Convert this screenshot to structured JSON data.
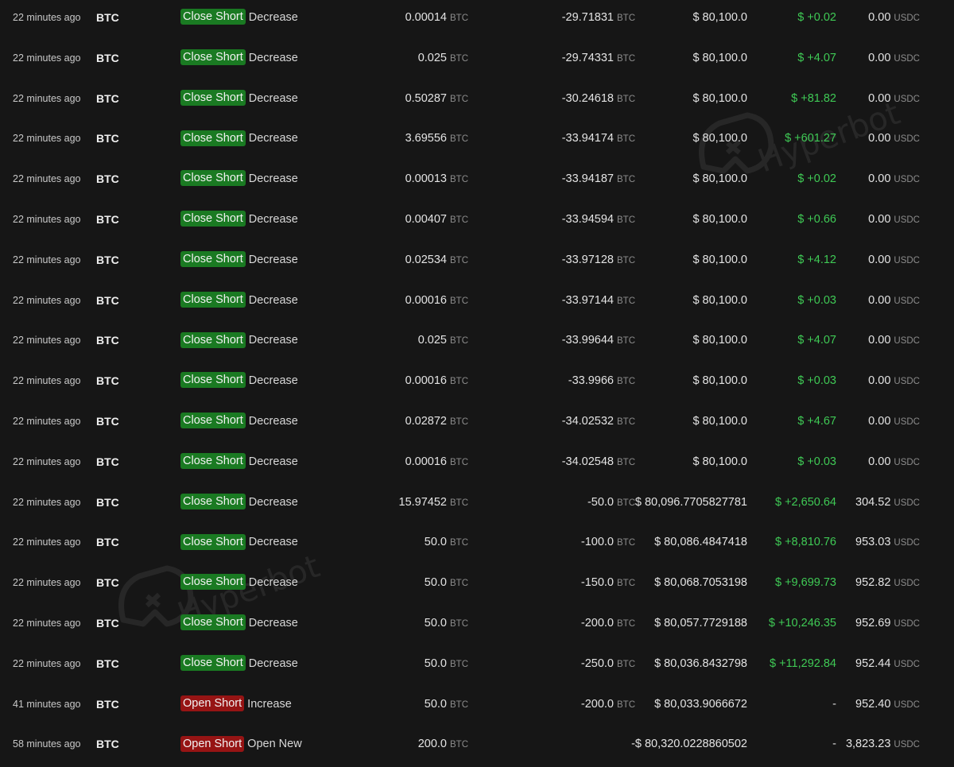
{
  "watermark": {
    "text": "Hyperbot"
  },
  "rows": [
    {
      "time": "22 minutes ago",
      "coin": "BTC",
      "type": "Close Short",
      "type_color": "green",
      "action": "Decrease",
      "size": "0.00014",
      "size_unit": "BTC",
      "position": "-29.71831",
      "position_unit": "BTC",
      "price": "$ 80,100.0",
      "pnl": "$ +0.02",
      "pnl_color": "green",
      "fee": "0.00",
      "fee_unit": "USDC"
    },
    {
      "time": "22 minutes ago",
      "coin": "BTC",
      "type": "Close Short",
      "type_color": "green",
      "action": "Decrease",
      "size": "0.025",
      "size_unit": "BTC",
      "position": "-29.74331",
      "position_unit": "BTC",
      "price": "$ 80,100.0",
      "pnl": "$ +4.07",
      "pnl_color": "green",
      "fee": "0.00",
      "fee_unit": "USDC"
    },
    {
      "time": "22 minutes ago",
      "coin": "BTC",
      "type": "Close Short",
      "type_color": "green",
      "action": "Decrease",
      "size": "0.50287",
      "size_unit": "BTC",
      "position": "-30.24618",
      "position_unit": "BTC",
      "price": "$ 80,100.0",
      "pnl": "$ +81.82",
      "pnl_color": "green",
      "fee": "0.00",
      "fee_unit": "USDC"
    },
    {
      "time": "22 minutes ago",
      "coin": "BTC",
      "type": "Close Short",
      "type_color": "green",
      "action": "Decrease",
      "size": "3.69556",
      "size_unit": "BTC",
      "position": "-33.94174",
      "position_unit": "BTC",
      "price": "$ 80,100.0",
      "pnl": "$ +601.27",
      "pnl_color": "green",
      "fee": "0.00",
      "fee_unit": "USDC"
    },
    {
      "time": "22 minutes ago",
      "coin": "BTC",
      "type": "Close Short",
      "type_color": "green",
      "action": "Decrease",
      "size": "0.00013",
      "size_unit": "BTC",
      "position": "-33.94187",
      "position_unit": "BTC",
      "price": "$ 80,100.0",
      "pnl": "$ +0.02",
      "pnl_color": "green",
      "fee": "0.00",
      "fee_unit": "USDC"
    },
    {
      "time": "22 minutes ago",
      "coin": "BTC",
      "type": "Close Short",
      "type_color": "green",
      "action": "Decrease",
      "size": "0.00407",
      "size_unit": "BTC",
      "position": "-33.94594",
      "position_unit": "BTC",
      "price": "$ 80,100.0",
      "pnl": "$ +0.66",
      "pnl_color": "green",
      "fee": "0.00",
      "fee_unit": "USDC"
    },
    {
      "time": "22 minutes ago",
      "coin": "BTC",
      "type": "Close Short",
      "type_color": "green",
      "action": "Decrease",
      "size": "0.02534",
      "size_unit": "BTC",
      "position": "-33.97128",
      "position_unit": "BTC",
      "price": "$ 80,100.0",
      "pnl": "$ +4.12",
      "pnl_color": "green",
      "fee": "0.00",
      "fee_unit": "USDC"
    },
    {
      "time": "22 minutes ago",
      "coin": "BTC",
      "type": "Close Short",
      "type_color": "green",
      "action": "Decrease",
      "size": "0.00016",
      "size_unit": "BTC",
      "position": "-33.97144",
      "position_unit": "BTC",
      "price": "$ 80,100.0",
      "pnl": "$ +0.03",
      "pnl_color": "green",
      "fee": "0.00",
      "fee_unit": "USDC"
    },
    {
      "time": "22 minutes ago",
      "coin": "BTC",
      "type": "Close Short",
      "type_color": "green",
      "action": "Decrease",
      "size": "0.025",
      "size_unit": "BTC",
      "position": "-33.99644",
      "position_unit": "BTC",
      "price": "$ 80,100.0",
      "pnl": "$ +4.07",
      "pnl_color": "green",
      "fee": "0.00",
      "fee_unit": "USDC"
    },
    {
      "time": "22 minutes ago",
      "coin": "BTC",
      "type": "Close Short",
      "type_color": "green",
      "action": "Decrease",
      "size": "0.00016",
      "size_unit": "BTC",
      "position": "-33.9966",
      "position_unit": "BTC",
      "price": "$ 80,100.0",
      "pnl": "$ +0.03",
      "pnl_color": "green",
      "fee": "0.00",
      "fee_unit": "USDC"
    },
    {
      "time": "22 minutes ago",
      "coin": "BTC",
      "type": "Close Short",
      "type_color": "green",
      "action": "Decrease",
      "size": "0.02872",
      "size_unit": "BTC",
      "position": "-34.02532",
      "position_unit": "BTC",
      "price": "$ 80,100.0",
      "pnl": "$ +4.67",
      "pnl_color": "green",
      "fee": "0.00",
      "fee_unit": "USDC"
    },
    {
      "time": "22 minutes ago",
      "coin": "BTC",
      "type": "Close Short",
      "type_color": "green",
      "action": "Decrease",
      "size": "0.00016",
      "size_unit": "BTC",
      "position": "-34.02548",
      "position_unit": "BTC",
      "price": "$ 80,100.0",
      "pnl": "$ +0.03",
      "pnl_color": "green",
      "fee": "0.00",
      "fee_unit": "USDC"
    },
    {
      "time": "22 minutes ago",
      "coin": "BTC",
      "type": "Close Short",
      "type_color": "green",
      "action": "Decrease",
      "size": "15.97452",
      "size_unit": "BTC",
      "position": "-50.0",
      "position_unit": "BTC",
      "price": "$ 80,096.7705827781",
      "pnl": "$ +2,650.64",
      "pnl_color": "green",
      "fee": "304.52",
      "fee_unit": "USDC"
    },
    {
      "time": "22 minutes ago",
      "coin": "BTC",
      "type": "Close Short",
      "type_color": "green",
      "action": "Decrease",
      "size": "50.0",
      "size_unit": "BTC",
      "position": "-100.0",
      "position_unit": "BTC",
      "price": "$ 80,086.4847418",
      "pnl": "$ +8,810.76",
      "pnl_color": "green",
      "fee": "953.03",
      "fee_unit": "USDC"
    },
    {
      "time": "22 minutes ago",
      "coin": "BTC",
      "type": "Close Short",
      "type_color": "green",
      "action": "Decrease",
      "size": "50.0",
      "size_unit": "BTC",
      "position": "-150.0",
      "position_unit": "BTC",
      "price": "$ 80,068.7053198",
      "pnl": "$ +9,699.73",
      "pnl_color": "green",
      "fee": "952.82",
      "fee_unit": "USDC"
    },
    {
      "time": "22 minutes ago",
      "coin": "BTC",
      "type": "Close Short",
      "type_color": "green",
      "action": "Decrease",
      "size": "50.0",
      "size_unit": "BTC",
      "position": "-200.0",
      "position_unit": "BTC",
      "price": "$ 80,057.7729188",
      "pnl": "$ +10,246.35",
      "pnl_color": "green",
      "fee": "952.69",
      "fee_unit": "USDC"
    },
    {
      "time": "22 minutes ago",
      "coin": "BTC",
      "type": "Close Short",
      "type_color": "green",
      "action": "Decrease",
      "size": "50.0",
      "size_unit": "BTC",
      "position": "-250.0",
      "position_unit": "BTC",
      "price": "$ 80,036.8432798",
      "pnl": "$ +11,292.84",
      "pnl_color": "green",
      "fee": "952.44",
      "fee_unit": "USDC"
    },
    {
      "time": "41 minutes ago",
      "coin": "BTC",
      "type": "Open Short",
      "type_color": "red",
      "action": "Increase",
      "size": "50.0",
      "size_unit": "BTC",
      "position": "-200.0",
      "position_unit": "BTC",
      "price": "$ 80,033.9066672",
      "pnl": "-",
      "pnl_color": "neutral",
      "fee": "952.40",
      "fee_unit": "USDC"
    },
    {
      "time": "58 minutes ago",
      "coin": "BTC",
      "type": "Open Short",
      "type_color": "red",
      "action": "Open New",
      "size": "200.0",
      "size_unit": "BTC",
      "position": "-",
      "position_unit": "",
      "price": "$ 80,320.0228860502",
      "pnl": "-",
      "pnl_color": "neutral",
      "fee": "3,823.23",
      "fee_unit": "USDC"
    }
  ]
}
